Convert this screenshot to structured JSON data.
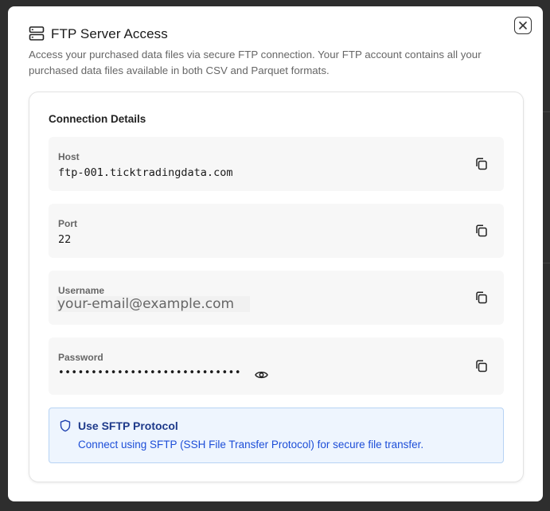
{
  "dialog": {
    "title": "FTP Server Access",
    "description": "Access your purchased data files via secure FTP connection. Your FTP account contains all your purchased data files available in both CSV and Parquet formats.",
    "close_icon": "close-icon",
    "header_icon": "server-icon"
  },
  "connection": {
    "title": "Connection Details",
    "host": {
      "label": "Host",
      "value": "ftp-001.ticktradingdata.com"
    },
    "port": {
      "label": "Port",
      "value": "22"
    },
    "username": {
      "label": "Username",
      "value": "your-email@example.com"
    },
    "password": {
      "label": "Password",
      "value": "••••••••••••••••••••••••••••"
    }
  },
  "sftp": {
    "title": "Use SFTP Protocol",
    "text": "Connect using SFTP (SSH File Transfer Protocol) for secure file transfer.",
    "icon": "shield-icon"
  },
  "colors": {
    "backdrop": "#2e2e2e",
    "info_bg": "#eef5fe",
    "info_border": "#b7d3f4",
    "info_title": "#1e3a8a",
    "info_text": "#1d4ed8"
  }
}
